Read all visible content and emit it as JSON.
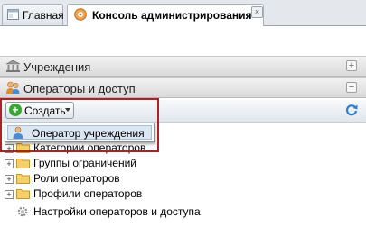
{
  "tabs": [
    {
      "label": "Главная",
      "icon": "home-icon"
    },
    {
      "label": "Консоль администрирования",
      "icon": "console-icon",
      "close": "×"
    }
  ],
  "accordion": [
    {
      "label": "Учреждения",
      "icon": "institution-icon",
      "toggle": "+"
    },
    {
      "label": "Операторы и доступ",
      "icon": "users-icon",
      "toggle": "−"
    }
  ],
  "toolbar": {
    "create_label": "Создать",
    "create_plus": "+"
  },
  "menu": {
    "items": [
      {
        "label": "Оператор учреждения",
        "icon": "operator-icon"
      }
    ]
  },
  "tree": [
    {
      "label": "Категории операторов",
      "expander": "+"
    },
    {
      "label": "Группы ограничений",
      "expander": "+"
    },
    {
      "label": "Роли операторов",
      "expander": "+"
    },
    {
      "label": "Профили операторов",
      "expander": "+"
    },
    {
      "label": "Настройки операторов и доступа",
      "icon": "gear-icon"
    }
  ],
  "colors": {
    "highlight": "#b21f23",
    "create_plus": "#3aa635",
    "menu_selected": "#dbe6f3"
  }
}
